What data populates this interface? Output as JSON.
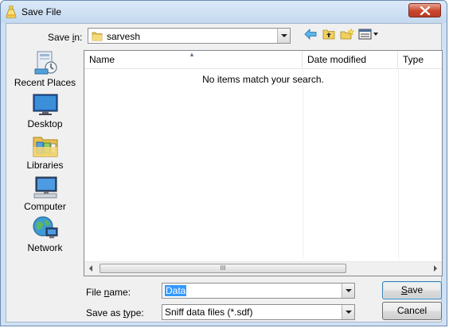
{
  "window": {
    "title": "Save File"
  },
  "toolbar": {
    "save_in_label_prefix": "Save ",
    "save_in_label_underlined": "i",
    "save_in_label_suffix": "n:",
    "current_folder": "sarvesh"
  },
  "places": [
    {
      "label": "Recent Places",
      "icon": "recent-places-icon"
    },
    {
      "label": "Desktop",
      "icon": "desktop-icon"
    },
    {
      "label": "Libraries",
      "icon": "libraries-icon"
    },
    {
      "label": "Computer",
      "icon": "computer-icon"
    },
    {
      "label": "Network",
      "icon": "network-icon"
    }
  ],
  "list": {
    "columns": [
      "Name",
      "Date modified",
      "Type"
    ],
    "empty_message": "No items match your search.",
    "scroll_grip": "III"
  },
  "form": {
    "file_name_label_prefix": "File ",
    "file_name_label_underlined": "n",
    "file_name_label_suffix": "ame:",
    "file_name_value": "Data",
    "save_as_type_label_prefix": "Save as ",
    "save_as_type_label_underlined": "t",
    "save_as_type_label_suffix": "ype:",
    "save_as_type_value": "Sniff data files (*.sdf)"
  },
  "buttons": {
    "save_underlined": "S",
    "save_rest": "ave",
    "cancel": "Cancel"
  },
  "colors": {
    "accent": "#3399ff",
    "titlebar": "#cfe1f3",
    "close": "#c9462c"
  }
}
